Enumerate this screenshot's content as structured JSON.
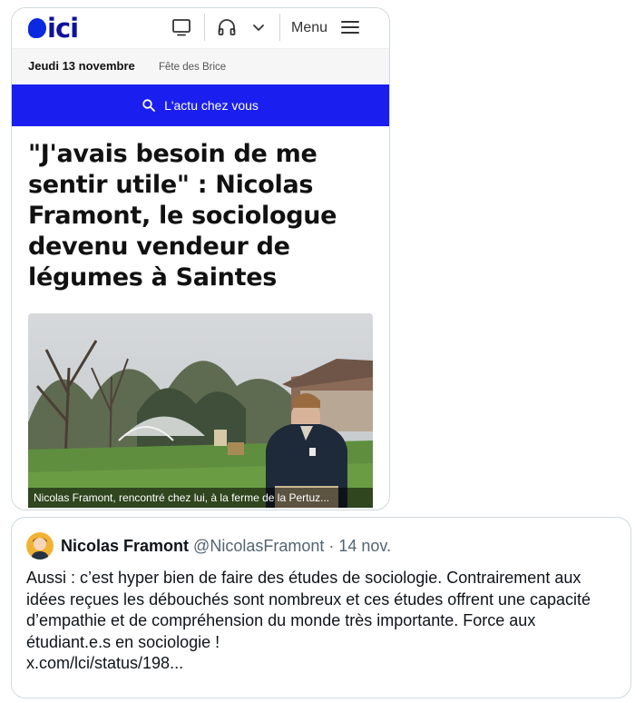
{
  "brand": {
    "logo_text": "ici",
    "accent": "#1a1ff0",
    "logo_color": "#10119a"
  },
  "header": {
    "icons": [
      "tv-icon",
      "headphones-icon",
      "chevron-down-icon",
      "hamburger-menu-icon"
    ],
    "menu_label": "Menu"
  },
  "datebar": {
    "date": "Jeudi 13 novembre",
    "fete": "Fête des Brice"
  },
  "search": {
    "label": "L'actu chez vous",
    "icon": "search-icon"
  },
  "article": {
    "headline": "\"J'avais besoin de me sentir utile\" : Nicolas Framont, le sociologue devenu vendeur de légumes à Saintes",
    "photo_caption": "Nicolas Framont, rencontré chez lui, à la ferme de la Pertuz..."
  },
  "tweet": {
    "author_name": "Nicolas Framont",
    "author_handle": "@NicolasFramont",
    "separator": " · ",
    "date": "14 nov.",
    "text": "Aussi : c’est hyper bien de faire des études de sociologie. Contrairement aux idées reçues les débouchés sont nombreux et ces études offrent une capacité d’empathie et de compréhension du monde très importante. Force aux étudiant.e.s en sociologie !",
    "link": "x.com/lci/status/198..."
  }
}
